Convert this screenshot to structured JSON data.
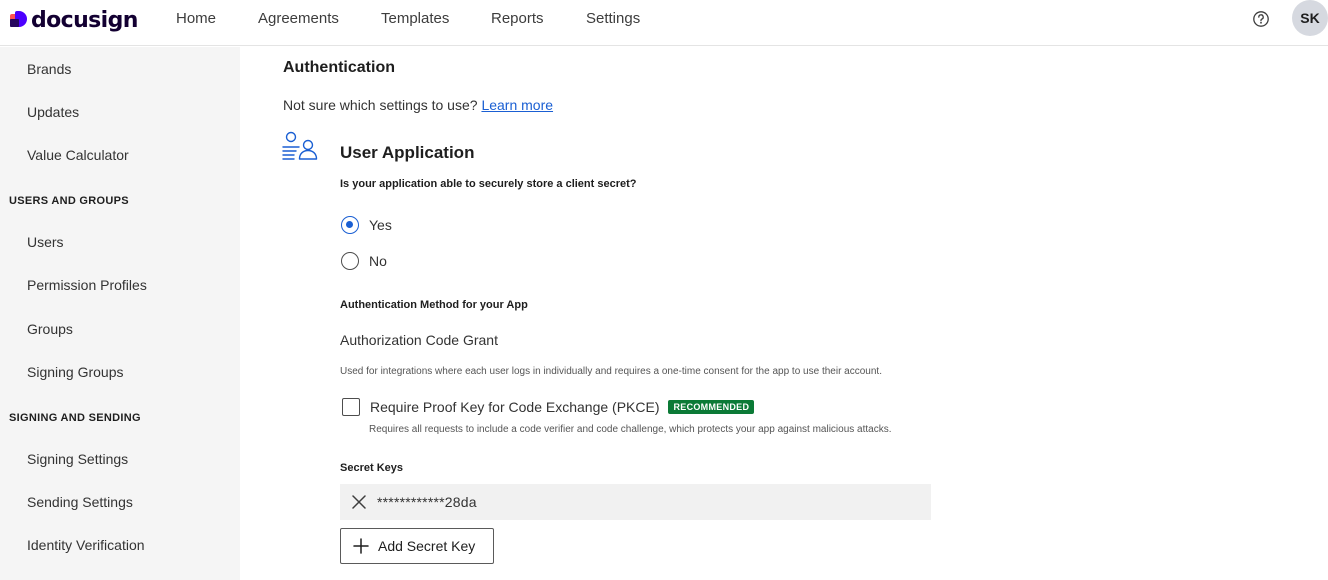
{
  "brand": {
    "name": "docusign"
  },
  "nav": [
    "Home",
    "Agreements",
    "Templates",
    "Reports",
    "Settings"
  ],
  "user": {
    "initials": "SK"
  },
  "sidebar": {
    "items_top": [
      "Brands",
      "Updates",
      "Value Calculator"
    ],
    "section_users": "USERS AND GROUPS",
    "items_users": [
      "Users",
      "Permission Profiles",
      "Groups",
      "Signing Groups"
    ],
    "section_signing": "SIGNING AND SENDING",
    "items_signing": [
      "Signing Settings",
      "Sending Settings",
      "Identity Verification"
    ]
  },
  "auth": {
    "heading": "Authentication",
    "hint": "Not sure which settings to use?",
    "learn_more": "Learn more",
    "user_app_title": "User Application",
    "question": "Is your application able to securely store a client secret?",
    "options": [
      "Yes",
      "No"
    ],
    "selected": "Yes",
    "method_label": "Authentication Method for your App",
    "method_value": "Authorization Code Grant",
    "method_desc": "Used for integrations where each user logs in individually and requires a one-time consent for the app to use their account.",
    "pkce_label": "Require Proof Key for Code Exchange (PKCE)",
    "pkce_badge": "RECOMMENDED",
    "pkce_desc": "Requires all requests to include a code verifier and code challenge, which protects your app against malicious attacks.",
    "pkce_checked": false,
    "secret_keys_label": "Secret Keys",
    "secret_key_value": "************28da",
    "add_key_label": "Add Secret Key"
  },
  "colors": {
    "accent": "#1a5fd3",
    "badge": "#0b7a36",
    "sidebar_bg": "#f5f5f5"
  }
}
